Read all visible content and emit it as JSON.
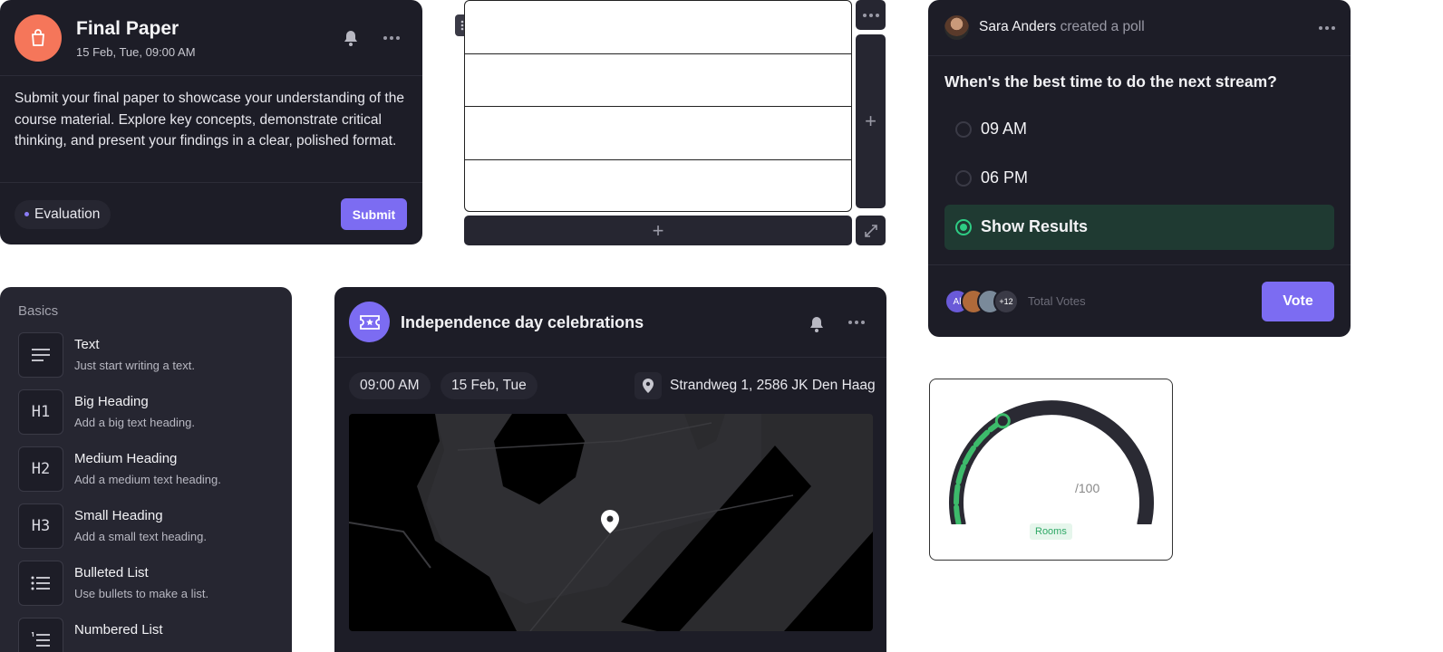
{
  "paper_card": {
    "title": "Final Paper",
    "date": "15 Feb, Tue, 09:00 AM",
    "description": "Submit your final paper to showcase your understanding of the course material. Explore key concepts, demonstrate critical thinking, and present your findings in a clear, polished format.",
    "tag": "Evaluation",
    "submit_label": "Submit",
    "avatar_icon": "shopping-bag-icon",
    "avatar_color": "#f5765a"
  },
  "grid": {
    "rows": 4,
    "add_symbol": "+"
  },
  "poll": {
    "author": "Sara Anders",
    "action": "created a poll",
    "question": "When's the best time to do the next stream?",
    "options": [
      {
        "label": "09 AM",
        "selected": false
      },
      {
        "label": "06 PM",
        "selected": false
      },
      {
        "label": "Show Results",
        "selected": true
      }
    ],
    "voters_initials": "Al",
    "extra_voters": "+12",
    "total_label": "Total Votes",
    "vote_label": "Vote",
    "accent": "#7c6cf2",
    "selected_color": "#2ecc84"
  },
  "basics": {
    "section_label": "Basics",
    "items": [
      {
        "icon": "lines-icon",
        "glyph": "",
        "title": "Text",
        "desc": "Just start writing a text."
      },
      {
        "icon": "h1-icon",
        "glyph": "H1",
        "title": "Big Heading",
        "desc": "Add a big text heading."
      },
      {
        "icon": "h2-icon",
        "glyph": "H2",
        "title": "Medium Heading",
        "desc": "Add a medium text heading."
      },
      {
        "icon": "h3-icon",
        "glyph": "H3",
        "title": "Small Heading",
        "desc": "Add a small text heading."
      },
      {
        "icon": "bulleted-list-icon",
        "glyph": "",
        "title": "Bulleted List",
        "desc": "Use bullets to make a list."
      },
      {
        "icon": "numbered-list-icon",
        "glyph": "",
        "title": "Numbered List",
        "desc": ""
      }
    ]
  },
  "event": {
    "title": "Independence day celebrations",
    "time": "09:00 AM",
    "date": "15 Feb, Tue",
    "address": "Strandweg 1, 2586 JK Den Haag",
    "icon": "ticket-icon"
  },
  "gauge": {
    "value_fraction": 0.35,
    "suffix": "/100",
    "label": "Rooms",
    "color": "#3dbb6b"
  }
}
